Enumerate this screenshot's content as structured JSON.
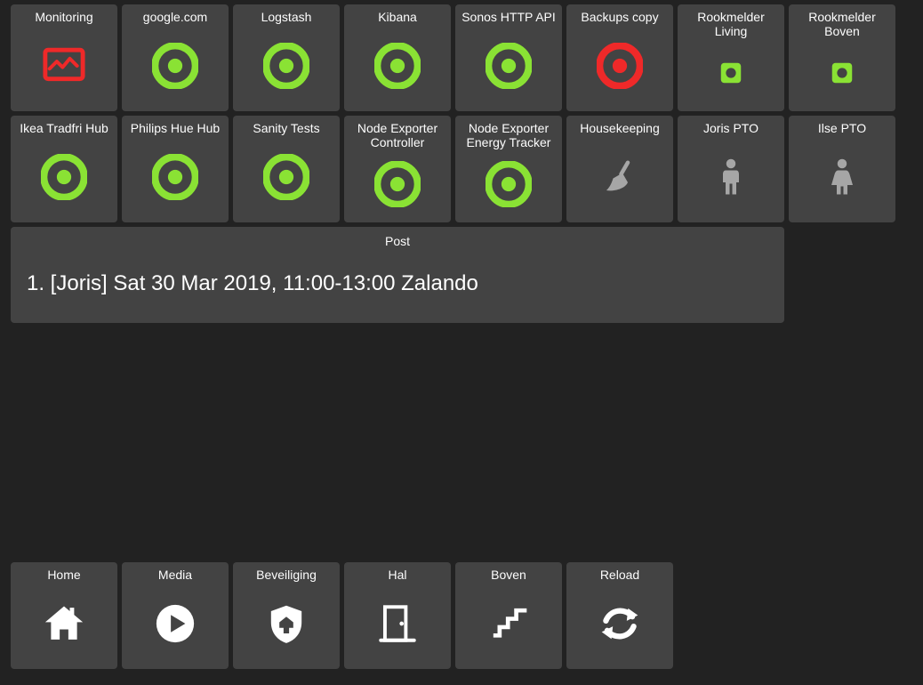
{
  "colors": {
    "green": "#8ae234",
    "red": "#ef2929",
    "grey": "#a6a6a6",
    "white": "#ffffff",
    "tile_bg": "#434343",
    "page_bg": "#222222"
  },
  "tiles": [
    {
      "label": "Monitoring",
      "icon": "monitor",
      "color": "red"
    },
    {
      "label": "google.com",
      "icon": "bullseye",
      "color": "green"
    },
    {
      "label": "Logstash",
      "icon": "bullseye",
      "color": "green"
    },
    {
      "label": "Kibana",
      "icon": "bullseye",
      "color": "green"
    },
    {
      "label": "Sonos HTTP API",
      "icon": "bullseye",
      "color": "green"
    },
    {
      "label": "Backups copy",
      "icon": "bullseye",
      "color": "red"
    },
    {
      "label": "Rookmelder Living",
      "icon": "square",
      "color": "green"
    },
    {
      "label": "Rookmelder Boven",
      "icon": "square",
      "color": "green"
    },
    {
      "label": "Ikea Tradfri Hub",
      "icon": "bullseye",
      "color": "green"
    },
    {
      "label": "Philips Hue Hub",
      "icon": "bullseye",
      "color": "green"
    },
    {
      "label": "Sanity Tests",
      "icon": "bullseye",
      "color": "green"
    },
    {
      "label": "Node Exporter Controller",
      "icon": "bullseye",
      "color": "green"
    },
    {
      "label": "Node Exporter Energy Tracker",
      "icon": "bullseye",
      "color": "green"
    },
    {
      "label": "Housekeeping",
      "icon": "broom",
      "color": "grey"
    },
    {
      "label": "Joris PTO",
      "icon": "male",
      "color": "grey"
    },
    {
      "label": "Ilse PTO",
      "icon": "female",
      "color": "grey"
    }
  ],
  "post": {
    "title": "Post",
    "body": "1. [Joris] Sat 30 Mar 2019, 11:00-13:00 Zalando"
  },
  "nav": [
    {
      "label": "Home",
      "icon": "home"
    },
    {
      "label": "Media",
      "icon": "play"
    },
    {
      "label": "Beveiliging",
      "icon": "shield"
    },
    {
      "label": "Hal",
      "icon": "door"
    },
    {
      "label": "Boven",
      "icon": "stairs"
    },
    {
      "label": "Reload",
      "icon": "reload"
    }
  ]
}
